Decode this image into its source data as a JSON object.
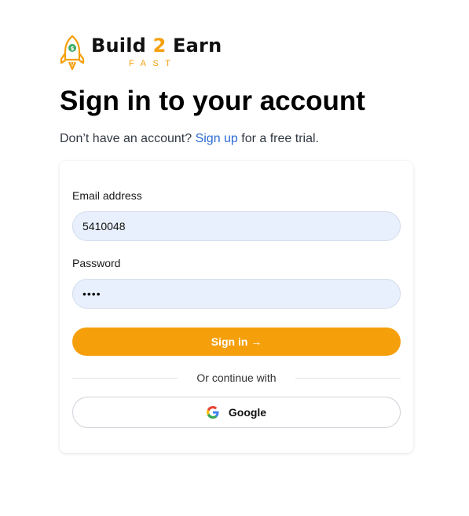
{
  "brand": {
    "name_part1": "Build ",
    "name_accent": "2",
    "name_part2": " Earn",
    "tagline": "FAST",
    "accent_color": "#f59f0a"
  },
  "heading": "Sign in to your account",
  "subtitle": {
    "prefix": "Don’t have an account? ",
    "link": "Sign up",
    "suffix": " for a free trial."
  },
  "form": {
    "email_label": "Email address",
    "email_value": "5410048",
    "password_label": "Password",
    "password_value": "••••",
    "submit_label": "Sign in →",
    "divider_text": "Or continue with",
    "google_label": "Google"
  },
  "icons": {
    "logo": "rocket-icon",
    "oauth": "google-icon"
  },
  "colors": {
    "primary": "#f59f0a",
    "link": "#2a6ad3",
    "input_bg": "#e8f0fe"
  }
}
